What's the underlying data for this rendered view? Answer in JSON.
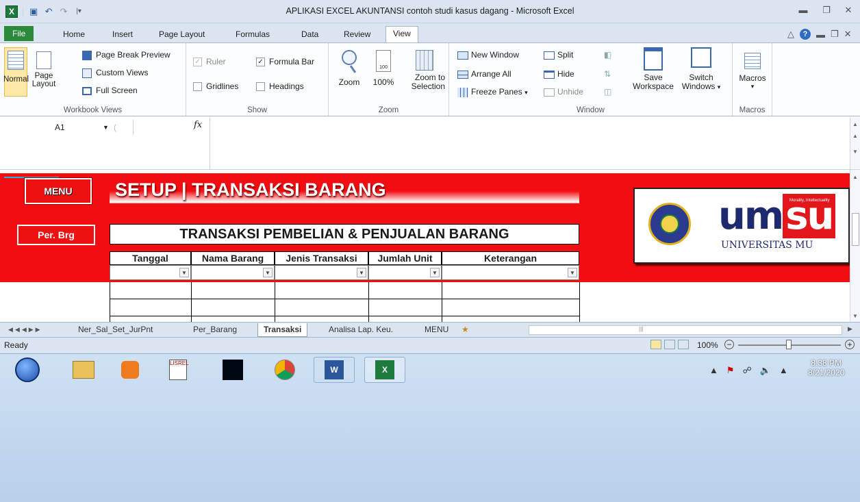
{
  "window": {
    "title": "APLIKASI EXCEL AKUNTANSI contoh studi kasus dagang  -  Microsoft Excel"
  },
  "tabs": [
    "File",
    "Home",
    "Insert",
    "Page Layout",
    "Formulas",
    "Data",
    "Review",
    "View"
  ],
  "ribbon": {
    "workbook_views": {
      "normal": "Normal",
      "page_layout": "Page Layout",
      "page_break_preview": "Page Break Preview",
      "custom_views": "Custom Views",
      "full_screen": "Full Screen",
      "label": "Workbook Views"
    },
    "show": {
      "ruler": "Ruler",
      "formula_bar": "Formula Bar",
      "gridlines": "Gridlines",
      "headings": "Headings",
      "label": "Show"
    },
    "zoom": {
      "zoom": "Zoom",
      "hundred": "100%",
      "zoom_to_selection": "Zoom to Selection",
      "label": "Zoom"
    },
    "window": {
      "new_window": "New Window",
      "arrange_all": "Arrange All",
      "freeze_panes": "Freeze Panes",
      "split": "Split",
      "hide": "Hide",
      "unhide": "Unhide",
      "save_workspace": "Save Workspace",
      "switch_windows": "Switch Windows",
      "label": "Window"
    },
    "macros": {
      "macros": "Macros",
      "label": "Macros"
    }
  },
  "formula_bar": {
    "name_box": "A1",
    "fx": "fx",
    "value": ""
  },
  "sheet": {
    "menu_button": "MENU",
    "per_brg_button": "Per. Brg",
    "header_title": "SETUP | TRANSAKSI BARANG",
    "table_title": "TRANSAKSI PEMBELIAN & PENJUALAN BARANG",
    "columns": [
      "Tanggal",
      "Nama Barang",
      "Jenis Transaksi",
      "Jumlah Unit",
      "Keterangan"
    ],
    "logo_text": "umsu",
    "logo_caption": "UNIVERSITAS MU",
    "logo_tagline": "Morality, Intellectuality"
  },
  "sheet_tabs": [
    "Ner_Sal_Set_JurPnt",
    "Per_Barang",
    "Transaksi",
    "Analisa Lap. Keu.",
    "MENU"
  ],
  "status_bar": {
    "ready": "Ready",
    "zoom": "100%"
  },
  "taskbar": {
    "time": "8:38 PM",
    "date": "8/21/2020"
  },
  "colors": {
    "header_red": "#f20d12",
    "ribbon_bg": "#dbe5f1",
    "file_tab": "#2a8a3a"
  }
}
